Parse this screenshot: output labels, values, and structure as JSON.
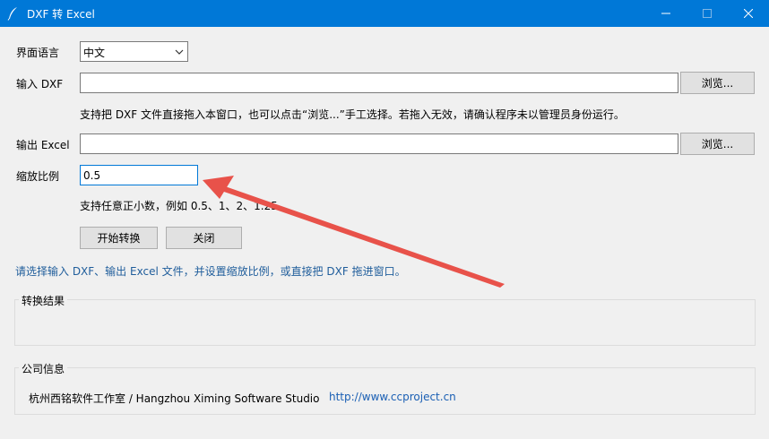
{
  "window": {
    "title": "DXF 转 Excel",
    "accent_color": "#0078d7"
  },
  "form": {
    "language_label": "界面语言",
    "language_value": "中文",
    "input_label": "输入 DXF",
    "input_value": "",
    "browse_label": "浏览...",
    "drag_hint": "支持把 DXF 文件直接拖入本窗口，也可以点击“浏览...”手工选择。若拖入无效，请确认程序未以管理员身份运行。",
    "output_label": "输出 Excel",
    "output_value": "",
    "scale_label": "缩放比例",
    "scale_value": "0.5",
    "scale_hint": "支持任意正小数，例如 0.5、1、2、1.25",
    "start_button": "开始转换",
    "close_button": "关闭"
  },
  "status_text": "请选择输入 DXF、输出 Excel 文件，并设置缩放比例，或直接把 DXF 拖进窗口。",
  "result_group": {
    "title": "转换结果"
  },
  "company_group": {
    "title": "公司信息",
    "name": "杭州西铭软件工作室 / Hangzhou Ximing Software Studio",
    "url": "http://www.ccproject.cn"
  },
  "annotation": {
    "arrow_color": "#e8524a"
  }
}
